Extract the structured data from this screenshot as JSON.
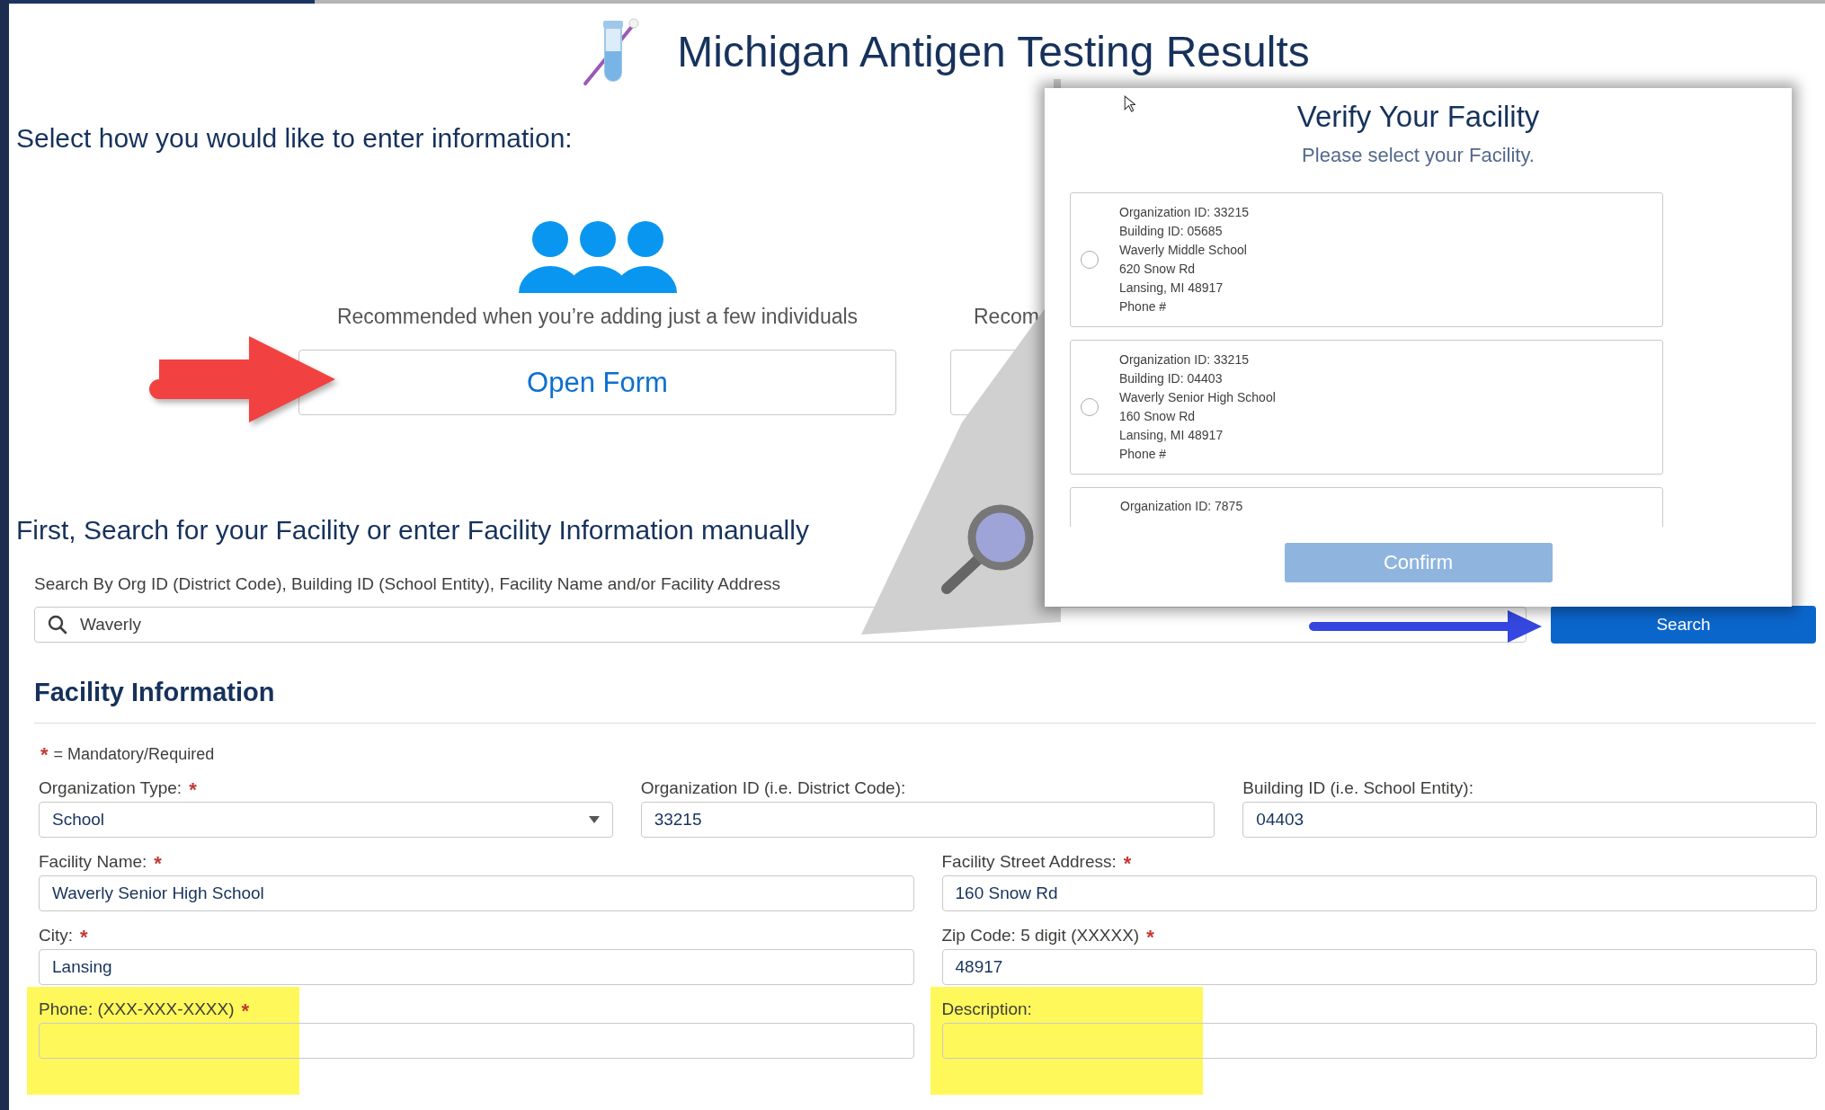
{
  "header": {
    "title": "Michigan Antigen Testing Results"
  },
  "entry": {
    "prompt": "Select how you would like to enter information:",
    "options": [
      {
        "caption": "Recommended when you’re adding just a few individuals",
        "button": "Open Form"
      },
      {
        "caption": "Recom"
      }
    ]
  },
  "search": {
    "heading": "First, Search for your Facility or enter Facility Information manually",
    "label": "Search By Org ID (District Code), Building ID (School Entity), Facility Name and/or Facility Address",
    "value": "Waverly",
    "button": "Search"
  },
  "facility_information": {
    "heading": "Facility Information",
    "legend_mark": "*",
    "legend": "= Mandatory/Required",
    "rows": [
      [
        {
          "label": "Organization Type:",
          "required": true,
          "value": "School",
          "kind": "select",
          "highlighted": false
        },
        {
          "label": "Organization ID (i.e. District Code):",
          "required": false,
          "value": "33215",
          "kind": "text",
          "highlighted": false
        },
        {
          "label": "Building ID (i.e. School Entity):",
          "required": false,
          "value": "04403",
          "kind": "text",
          "highlighted": false
        }
      ],
      [
        {
          "label": "Facility Name:",
          "required": true,
          "value": "Waverly Senior High School",
          "kind": "text",
          "highlighted": false
        },
        {
          "label": "Facility Street Address:",
          "required": true,
          "value": "160 Snow Rd",
          "kind": "text",
          "highlighted": false
        }
      ],
      [
        {
          "label": "City:",
          "required": true,
          "value": "Lansing",
          "kind": "text",
          "highlighted": false
        },
        {
          "label": "Zip Code: 5 digit (XXXXX)",
          "required": true,
          "value": "48917",
          "kind": "text",
          "highlighted": false
        }
      ],
      [
        {
          "label": "Phone: (XXX-XXX-XXXX)",
          "required": true,
          "kind": "text",
          "highlighted": true
        },
        {
          "label": "Description:",
          "required": false,
          "kind": "text",
          "highlighted": true
        }
      ]
    ]
  },
  "modal": {
    "title": "Verify Your Facility",
    "subtitle": "Please select your Facility.",
    "facilities": [
      {
        "lines": [
          "Organization ID: 33215",
          "Building ID: 05685",
          "Waverly Middle School",
          "620 Snow Rd",
          "Lansing, MI 48917",
          "Phone #"
        ],
        "selected": false
      },
      {
        "lines": [
          "Organization ID: 33215",
          "Building ID: 04403",
          "Waverly Senior High School",
          "160 Snow Rd",
          "Lansing, MI 48917",
          "Phone #"
        ],
        "selected": false
      }
    ],
    "partial_facility": {
      "lines": [
        "Organization ID: 7875"
      ]
    },
    "confirm": {
      "label": "Confirm",
      "disabled": true
    }
  }
}
